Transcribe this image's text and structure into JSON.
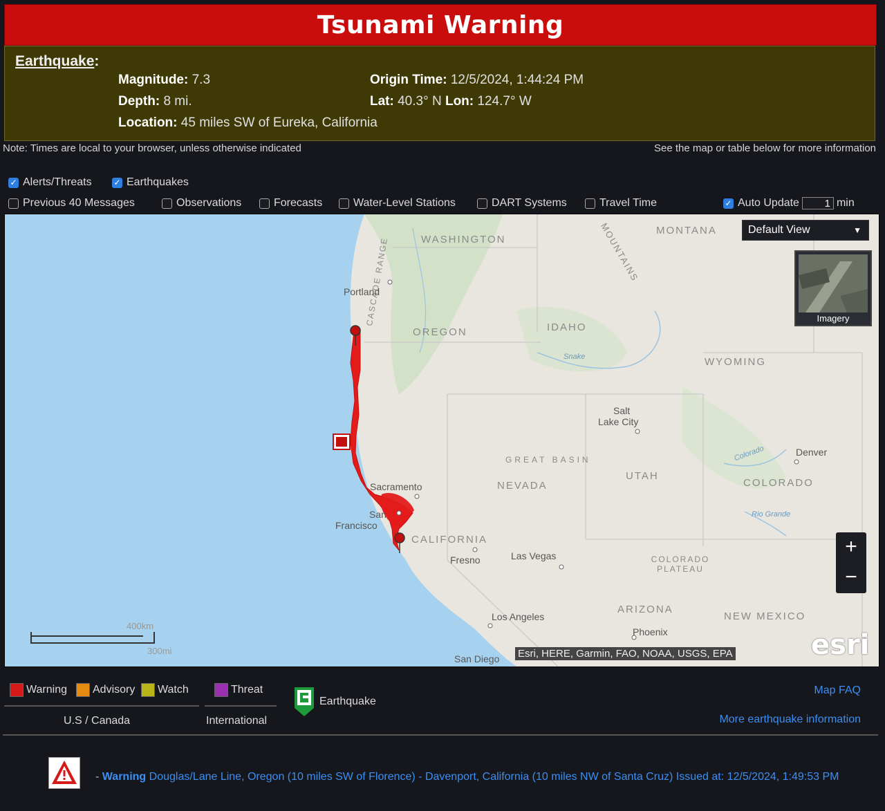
{
  "banner": {
    "title": "Tsunami Warning"
  },
  "earthquake": {
    "heading": "Earthquake",
    "heading_colon": ":",
    "magnitude_label": "Magnitude:",
    "magnitude": "7.3",
    "depth_label": "Depth:",
    "depth": "8 mi.",
    "location_label": "Location:",
    "location": "45 miles SW of Eureka, California",
    "origin_label": "Origin Time:",
    "origin": "12/5/2024, 1:44:24 PM",
    "lat_label": "Lat:",
    "lat": "40.3° N",
    "lon_label": "Lon:",
    "lon": "124.7° W"
  },
  "notes": {
    "left": "Note: Times are local to your browser, unless otherwise indicated",
    "right": "See the map or table below for more information"
  },
  "layers": {
    "alerts": {
      "label": "Alerts/Threats",
      "checked": true
    },
    "earthquakes": {
      "label": "Earthquakes",
      "checked": true
    },
    "previous": {
      "label": "Previous 40 Messages",
      "checked": false
    },
    "observations": {
      "label": "Observations",
      "checked": false
    },
    "forecasts": {
      "label": "Forecasts",
      "checked": false
    },
    "water_level": {
      "label": "Water-Level Stations",
      "checked": false
    },
    "dart": {
      "label": "DART Systems",
      "checked": false
    },
    "travel_time": {
      "label": "Travel Time",
      "checked": false
    },
    "auto_update": {
      "label": "Auto Update",
      "checked": true,
      "value": "1",
      "unit": "min"
    }
  },
  "map": {
    "view_select": "Default View",
    "basemap_label": "Imagery",
    "zoom_in": "+",
    "zoom_out": "−",
    "attribution": "Esri, HERE, Garmin, FAO, NOAA, USGS, EPA",
    "logo": "esri",
    "scale_km": "400km",
    "scale_mi": "300mi",
    "states": {
      "washington": "WASHINGTON",
      "montana": "MONTANA",
      "oregon": "OREGON",
      "idaho": "IDAHO",
      "wyoming": "WYOMING",
      "nevada": "NEVADA",
      "utah": "UTAH",
      "colorado": "COLORADO",
      "california": "CALIFORNIA",
      "arizona": "ARIZONA",
      "new_mexico": "NEW MEXICO",
      "great_basin": "GREAT BASIN",
      "colorado_plateau": "COLORADO PLATEAU",
      "cascade_range": "CASCADE RANGE",
      "rocky_mountains": "MOUNTAINS",
      "snake": "Snake",
      "rio_grande": "Rio Grande",
      "colorado_river": "Colorado"
    },
    "cities": {
      "portland": "Portland",
      "sacramento": "Sacramento",
      "san": "San",
      "francisco": "Francisco",
      "fresno": "Fresno",
      "las_vegas": "Las Vegas",
      "salt": "Salt",
      "lake_city": "Lake City",
      "denver": "Denver",
      "los_angeles": "Los Angeles",
      "phoenix": "Phoenix",
      "san_diego": "San Diego"
    },
    "warning_color": "#e31b1b"
  },
  "legend": {
    "warning": {
      "label": "Warning",
      "color": "#d61a1a"
    },
    "advisory": {
      "label": "Advisory",
      "color": "#e58b12"
    },
    "watch": {
      "label": "Watch",
      "color": "#b9b519"
    },
    "threat": {
      "label": "Threat",
      "color": "#9a2fb0"
    },
    "us_canada": "U.S / Canada",
    "international": "International",
    "earthquake": "Earthquake",
    "map_faq": "Map FAQ",
    "more_info": "More earthquake information"
  },
  "alert": {
    "dash": "-",
    "level": "Warning",
    "text": "Douglas/Lane Line, Oregon (10 miles SW of Florence) - Davenport, California (10 miles NW of Santa Cruz)",
    "issued_label": "Issued at:",
    "issued": "12/5/2024, 1:49:53 PM"
  }
}
